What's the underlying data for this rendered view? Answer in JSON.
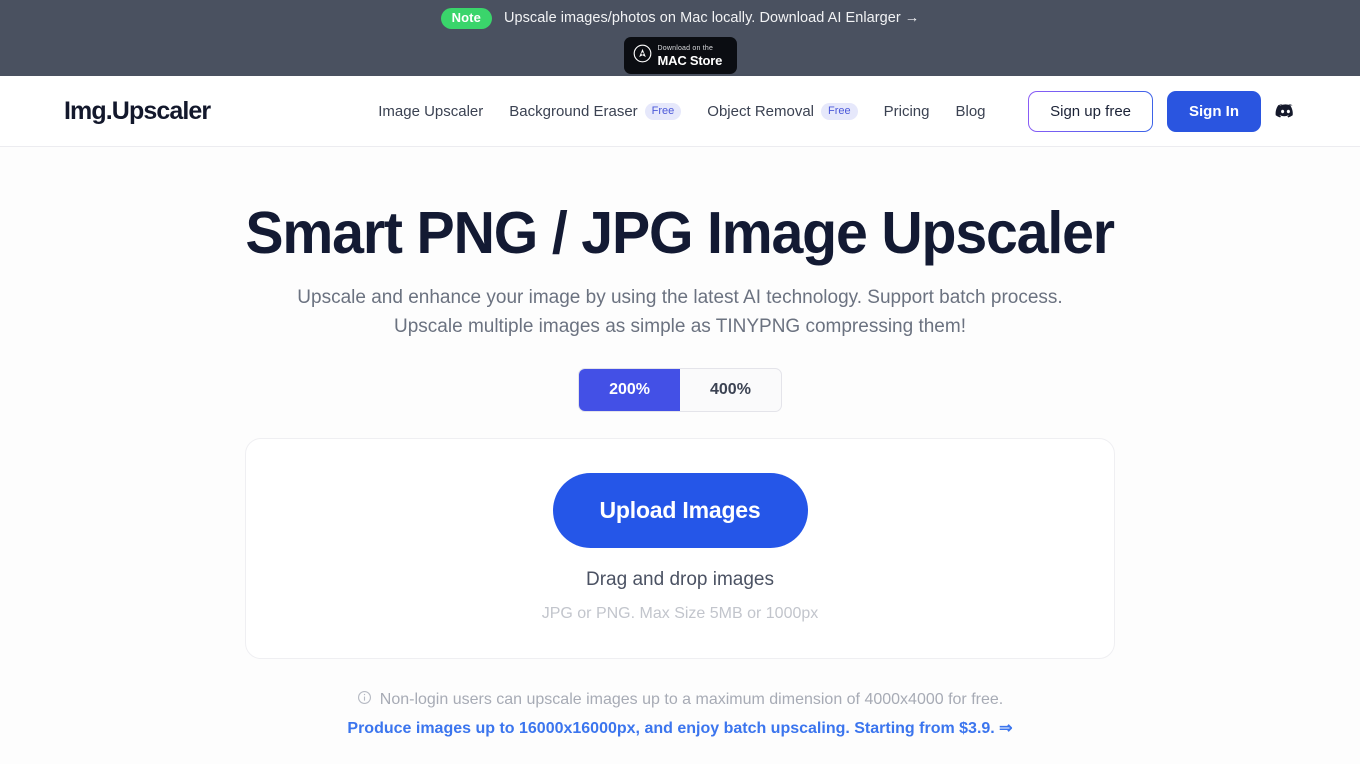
{
  "banner": {
    "badge": "Note",
    "text": "Upscale images/photos on Mac locally. Download AI Enlarger →",
    "store_small": "Download on the",
    "store_big": "MAC Store",
    "badge_color": "#3ad56b",
    "bg_color": "#4a5160"
  },
  "header": {
    "logo": "Img.Upscaler",
    "nav": [
      {
        "label": "Image Upscaler",
        "badge": ""
      },
      {
        "label": "Background Eraser",
        "badge": "Free"
      },
      {
        "label": "Object Removal",
        "badge": "Free"
      },
      {
        "label": "Pricing",
        "badge": ""
      },
      {
        "label": "Blog",
        "badge": ""
      }
    ],
    "signup_label": "Sign up free",
    "signin_label": "Sign In",
    "discord_name": "discord-icon"
  },
  "hero": {
    "headline": "Smart PNG / JPG Image Upscaler",
    "subtitle": "Upscale and enhance your image by using the latest AI technology. Support batch process. Upscale multiple images as simple as TINYPNG compressing them!"
  },
  "scale": {
    "options": [
      {
        "label": "200%",
        "active": true
      },
      {
        "label": "400%",
        "active": false
      }
    ],
    "active_color": "#4350e6"
  },
  "dropzone": {
    "upload_label": "Upload Images",
    "drag_text": "Drag and drop images",
    "constraints": "JPG or PNG. Max Size 5MB or 1000px",
    "upload_color": "#2556e8"
  },
  "footnote": {
    "info_icon": "info-circle-icon",
    "text": "Non-login users can upscale images up to a maximum dimension of 4000x4000 for free.",
    "link": "Produce images up to 16000x16000px, and enjoy batch upscaling. Starting from $3.9. ⇒",
    "link_color": "#3b75ee"
  }
}
